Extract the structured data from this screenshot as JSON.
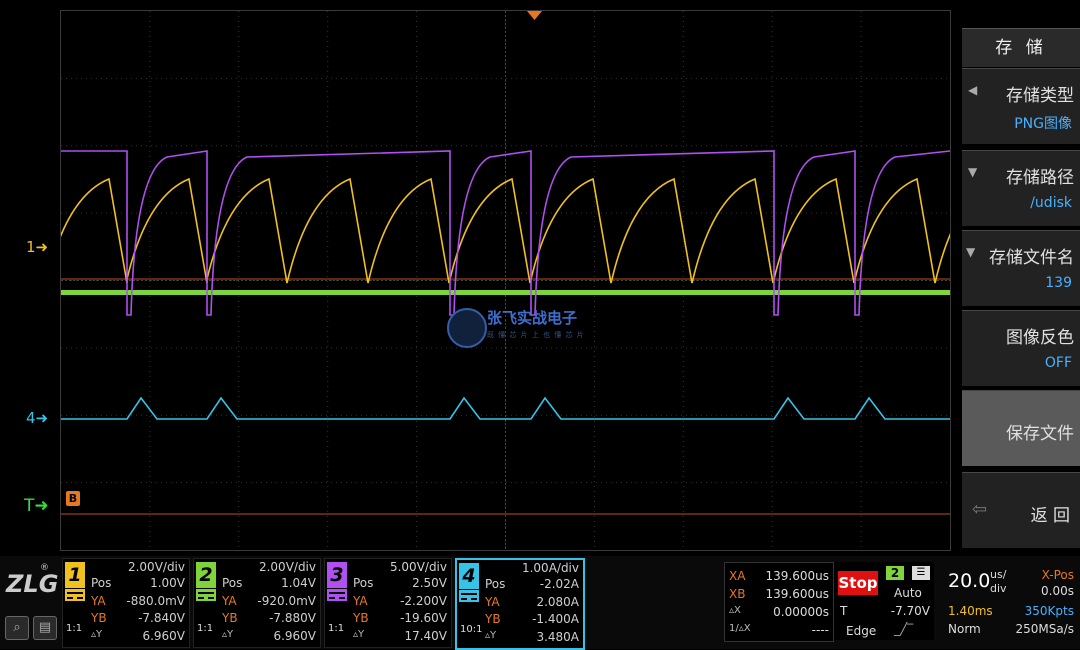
{
  "screen": {
    "ch1_marker": "1",
    "ch4_marker": "4",
    "trigger_marker": "T",
    "trigger_flag": "B",
    "watermark": "张飞实战电子",
    "watermark_sub": "既 懂 芯 片 上 也 懂 芯 片"
  },
  "menu": {
    "title": "存 储",
    "items": [
      {
        "label": "存储类型",
        "value": "PNG图像"
      },
      {
        "label": "存储路径",
        "value": "/udisk"
      },
      {
        "label": "存储文件名",
        "value": "139"
      },
      {
        "label": "图像反色",
        "value": "OFF"
      },
      {
        "label": "保存文件",
        "value": ""
      },
      {
        "label": "返 回",
        "value": ""
      }
    ]
  },
  "channels": [
    {
      "num": "1",
      "color": "#f0c020",
      "scale": "2.00V/div",
      "pos_label": "Pos",
      "pos": "1.00V",
      "ya_label": "YA",
      "ya": "-880.0mV",
      "yb_label": "YB",
      "yb": "-7.840V",
      "dy_label": "▵Y",
      "dy": "6.960V",
      "probe": "1:1"
    },
    {
      "num": "2",
      "color": "#7ed43a",
      "scale": "2.00V/div",
      "pos_label": "Pos",
      "pos": "1.04V",
      "ya_label": "YA",
      "ya": "-920.0mV",
      "yb_label": "YB",
      "yb": "-7.880V",
      "dy_label": "▵Y",
      "dy": "6.960V",
      "probe": "1:1"
    },
    {
      "num": "3",
      "color": "#b050f0",
      "scale": "5.00V/div",
      "pos_label": "Pos",
      "pos": "2.50V",
      "ya_label": "YA",
      "ya": "-2.200V",
      "yb_label": "YB",
      "yb": "-19.60V",
      "dy_label": "▵Y",
      "dy": "17.40V",
      "probe": "1:1"
    },
    {
      "num": "4",
      "color": "#35c4e8",
      "scale": "1.00A/div",
      "pos_label": "Pos",
      "pos": "-2.02A",
      "ya_label": "YA",
      "ya": "2.080A",
      "yb_label": "YB",
      "yb": "-1.400A",
      "dy_label": "▵Y",
      "dy": "3.480A",
      "probe": "10:1"
    }
  ],
  "cursors": {
    "xa_label": "XA",
    "xa": "139.600us",
    "xb_label": "XB",
    "xb": "139.600us",
    "dx_label": "▵X",
    "dx": "0.00000s",
    "inv_label": "1/▵X",
    "inv": "----"
  },
  "trigger": {
    "state": "Stop",
    "source": "2",
    "mode": "Auto",
    "t_label": "T",
    "level": "-7.70V",
    "type": "Edge"
  },
  "timebase": {
    "scale": "20.0",
    "unit_top": "us/",
    "unit_bottom": "div",
    "xpos_label": "X-Pos",
    "xpos": "0.00s",
    "window": "1.40ms",
    "points": "350Kpts",
    "acq": "Norm",
    "rate": "250MSa/s"
  },
  "brand": {
    "logo": "ZLG",
    "reg": "®"
  },
  "colors": {
    "ch1": "#f0c020",
    "ch2": "#7ed43a",
    "ch3": "#b050f0",
    "ch4": "#35c4e8",
    "trigger": "#e87722",
    "menu_value": "#4ab0ff"
  }
}
